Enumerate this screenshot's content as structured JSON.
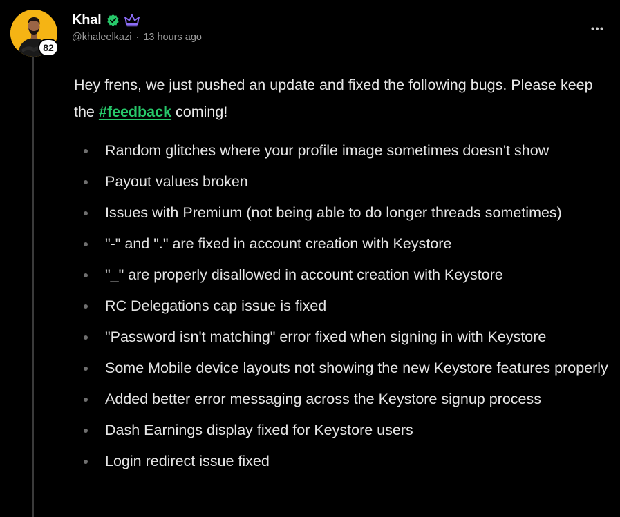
{
  "author": {
    "display_name": "Khal",
    "handle": "@khaleelkazi",
    "timestamp": "13 hours ago",
    "reputation": "82",
    "verified_icon": "verified-check-icon",
    "premium_icon": "crown-icon",
    "verified_color": "#27c86a",
    "premium_color": "#8b6cf6"
  },
  "post": {
    "intro_before": "Hey frens, we just pushed an update and fixed the following bugs. Please keep the ",
    "hashtag": "#feedback",
    "intro_after": " coming!",
    "hashtag_color": "#27c86a",
    "items": [
      "Random glitches where your profile image sometimes doesn't show",
      "Payout values broken",
      "Issues with Premium (not being able to do longer threads sometimes)",
      "\"-\" and \".\" are fixed in account creation with Keystore",
      "\"_\" are properly disallowed in account creation with Keystore",
      "RC Delegations cap issue is fixed",
      "\"Password isn't matching\" error fixed when signing in with Keystore",
      "Some Mobile device layouts not showing the new Keystore features properly",
      "Added better error messaging across the Keystore signup process",
      "Dash Earnings display fixed for Keystore users",
      "Login redirect issue fixed"
    ]
  },
  "actions": {
    "more_icon": "more-horizontal-icon"
  },
  "colors": {
    "background": "#000000",
    "text": "#e5e5e5",
    "muted": "#9a9a9a",
    "avatar_bg": "#f5b414"
  }
}
